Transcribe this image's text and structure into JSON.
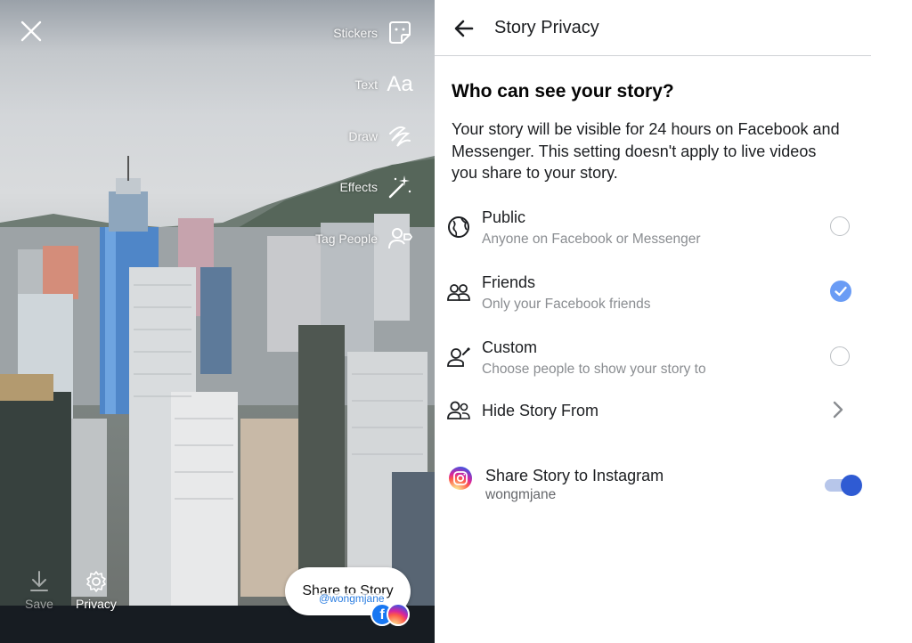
{
  "editor": {
    "tools": [
      {
        "label": "Stickers",
        "icon": "sticker-icon"
      },
      {
        "label": "Text",
        "icon": "text-aa-icon",
        "glyph": "Aa"
      },
      {
        "label": "Draw",
        "icon": "draw-squiggle-icon"
      },
      {
        "label": "Effects",
        "icon": "magic-wand-icon"
      },
      {
        "label": "Tag People",
        "icon": "tag-person-icon"
      }
    ],
    "save_label": "Save",
    "privacy_label": "Privacy",
    "share_label": "Share to Story",
    "handle": "@wongmjane",
    "fb_glyph": "f"
  },
  "panel": {
    "title": "Story Privacy",
    "question": "Who can see your story?",
    "description": "Your story will be visible for 24 hours on Facebook and Messenger. This setting doesn't apply to live videos you share to your story.",
    "options": [
      {
        "title": "Public",
        "subtitle": "Anyone on Facebook or Messenger",
        "icon": "globe-icon",
        "selected": false
      },
      {
        "title": "Friends",
        "subtitle": "Only your Facebook friends",
        "icon": "friends-icon",
        "selected": true
      },
      {
        "title": "Custom",
        "subtitle": "Choose people to show your story to",
        "icon": "custom-person-icon",
        "selected": false
      }
    ],
    "hide_story_label": "Hide Story From",
    "instagram": {
      "title": "Share Story to Instagram",
      "account": "wongmjane",
      "enabled": true
    }
  },
  "colors": {
    "accent": "#6a9cf5",
    "toggle_knob": "#2f5bd3",
    "facebook": "#1877f2",
    "bottom_bar": "#171c22"
  }
}
